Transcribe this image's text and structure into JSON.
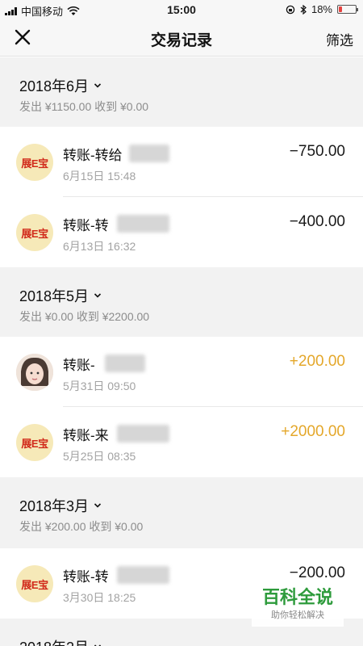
{
  "status_bar": {
    "carrier": "中国移动",
    "time": "15:00",
    "battery": "18%",
    "battery_level": 0.18,
    "battery_color": "#e64340"
  },
  "nav": {
    "title": "交易记录",
    "filter_label": "筛选",
    "close_icon": "close-icon"
  },
  "months": [
    {
      "title": "2018年6月",
      "summary": "发出 ¥1150.00 收到 ¥0.00",
      "transactions": [
        {
          "title": "转账-转给",
          "time": "6月15日 15:48",
          "amount": "−750.00",
          "type": "out",
          "avatar": "展E宝"
        },
        {
          "title": "转账-转",
          "time": "6月13日 16:32",
          "amount": "−400.00",
          "type": "out",
          "avatar": "展E宝"
        }
      ]
    },
    {
      "title": "2018年5月",
      "summary": "发出 ¥0.00 收到 ¥2200.00",
      "transactions": [
        {
          "title": "转账-",
          "time": "5月31日 09:50",
          "amount": "+200.00",
          "type": "in",
          "avatar": "person-avatar"
        },
        {
          "title": "转账-来",
          "time": "5月25日 08:35",
          "amount": "+2000.00",
          "type": "in",
          "avatar": "展E宝"
        }
      ]
    },
    {
      "title": "2018年3月",
      "summary": "发出 ¥200.00 收到 ¥0.00",
      "transactions": [
        {
          "title": "转账-转",
          "time": "3月30日 18:25",
          "amount": "−200.00",
          "type": "out",
          "avatar": "展E宝"
        }
      ]
    },
    {
      "title": "2018年2月",
      "summary": "",
      "transactions": []
    }
  ],
  "colors": {
    "income": "#e4a72a",
    "expense": "#1a1a1a"
  },
  "watermark": {
    "title": "百科全说",
    "subtitle": "助你轻松解决"
  }
}
